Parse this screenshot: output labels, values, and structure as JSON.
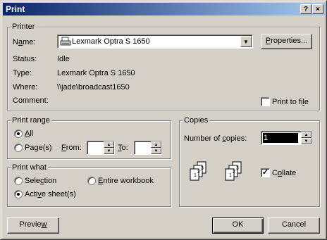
{
  "window": {
    "title": "Print",
    "help_label": "?",
    "close_label": "×"
  },
  "printer": {
    "group_label": "Printer",
    "name_label": "Name:",
    "name_value": "Lexmark Optra S 1650",
    "properties_label": "Properties...",
    "status_label": "Status:",
    "status_value": "Idle",
    "type_label": "Type:",
    "type_value": "Lexmark Optra S 1650",
    "where_label": "Where:",
    "where_value": "\\\\jade\\broadcast1650",
    "comment_label": "Comment:",
    "print_to_file_label": "Print to file",
    "print_to_file_checked": false
  },
  "print_range": {
    "group_label": "Print range",
    "all_label": "All",
    "pages_label": "Page(s)",
    "from_label": "From:",
    "to_label": "To:",
    "from_value": "",
    "to_value": "",
    "selected": "all"
  },
  "print_what": {
    "group_label": "Print what",
    "selection_label": "Selection",
    "entire_workbook_label": "Entire workbook",
    "active_sheets_label": "Active sheet(s)",
    "selected": "active_sheets"
  },
  "copies": {
    "group_label": "Copies",
    "number_label": "Number of copies:",
    "number_value": "1",
    "collate_label": "Collate",
    "collate_checked": true
  },
  "buttons": {
    "preview_label": "Preview",
    "ok_label": "OK",
    "cancel_label": "Cancel"
  },
  "colors": {
    "titlebar_start": "#0a246a",
    "titlebar_end": "#a6caf0",
    "face": "#d4d0c8"
  }
}
